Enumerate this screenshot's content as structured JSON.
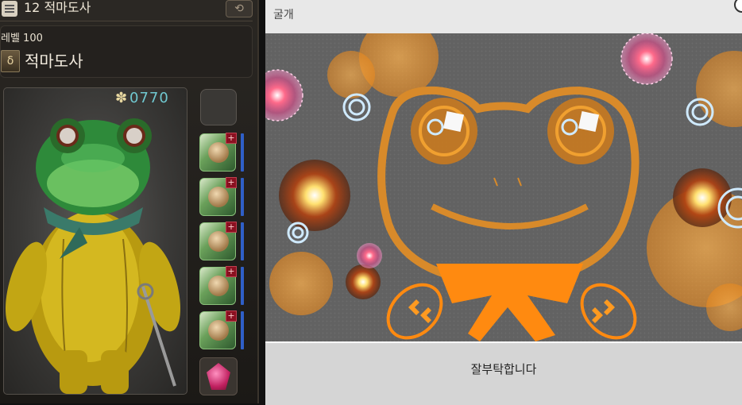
{
  "gearset": {
    "number_title": "12 적마도사"
  },
  "character": {
    "level_label": "레벨 100",
    "job_name": "적마도사",
    "item_level_icon": "star-icon",
    "item_level": "0770"
  },
  "gear_slots": [
    {
      "name": "gear-slot-1",
      "badge": "+"
    },
    {
      "name": "gear-slot-2",
      "badge": "+"
    },
    {
      "name": "gear-slot-3",
      "badge": "+"
    },
    {
      "name": "gear-slot-4",
      "badge": "+"
    },
    {
      "name": "gear-slot-5",
      "badge": "+"
    }
  ],
  "minigame": {
    "window_title": "굴개",
    "message": "잘부탁합니다"
  },
  "colors": {
    "accent_orange": "#ff8a10",
    "ring_blue": "#bfe4ff",
    "ring_pink": "#ff7aa0",
    "field_gray": "#626262"
  }
}
